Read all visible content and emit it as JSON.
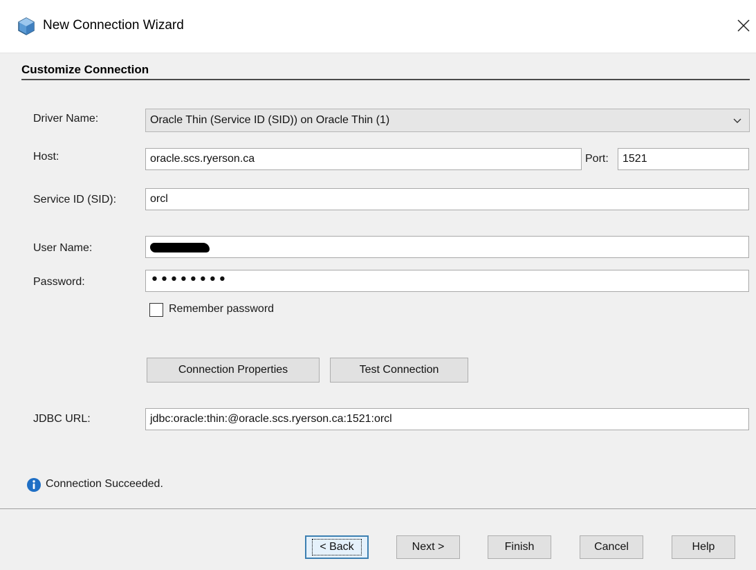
{
  "window": {
    "title": "New Connection Wizard",
    "app_icon": "netbeans-cube-icon",
    "close_icon": "close-icon"
  },
  "section": {
    "title": "Customize Connection"
  },
  "form": {
    "driver_label": "Driver Name:",
    "driver_value": "Oracle Thin (Service ID (SID)) on Oracle Thin (1)",
    "host_label": "Host:",
    "host_value": "oracle.scs.ryerson.ca",
    "port_label": "Port:",
    "port_value": "1521",
    "sid_label": "Service ID (SID):",
    "sid_value": "orcl",
    "user_label": "User Name:",
    "user_value_redacted": true,
    "password_label": "Password:",
    "password_mask": "••••••••",
    "remember_label": "Remember password",
    "remember_checked": false,
    "jdbc_label": "JDBC URL:",
    "jdbc_value": "jdbc:oracle:thin:@oracle.scs.ryerson.ca:1521:orcl"
  },
  "buttons": {
    "connection_properties": "Connection Properties",
    "test_connection": "Test Connection"
  },
  "status": {
    "icon": "info-icon",
    "text": "Connection Succeeded."
  },
  "footer": {
    "back": "< Back",
    "next": "Next >",
    "finish": "Finish",
    "cancel": "Cancel",
    "help": "Help"
  },
  "colors": {
    "dialog_bg": "#f0f0f0",
    "info_blue": "#1f6fc5",
    "default_button_border": "#3c7fb1"
  }
}
